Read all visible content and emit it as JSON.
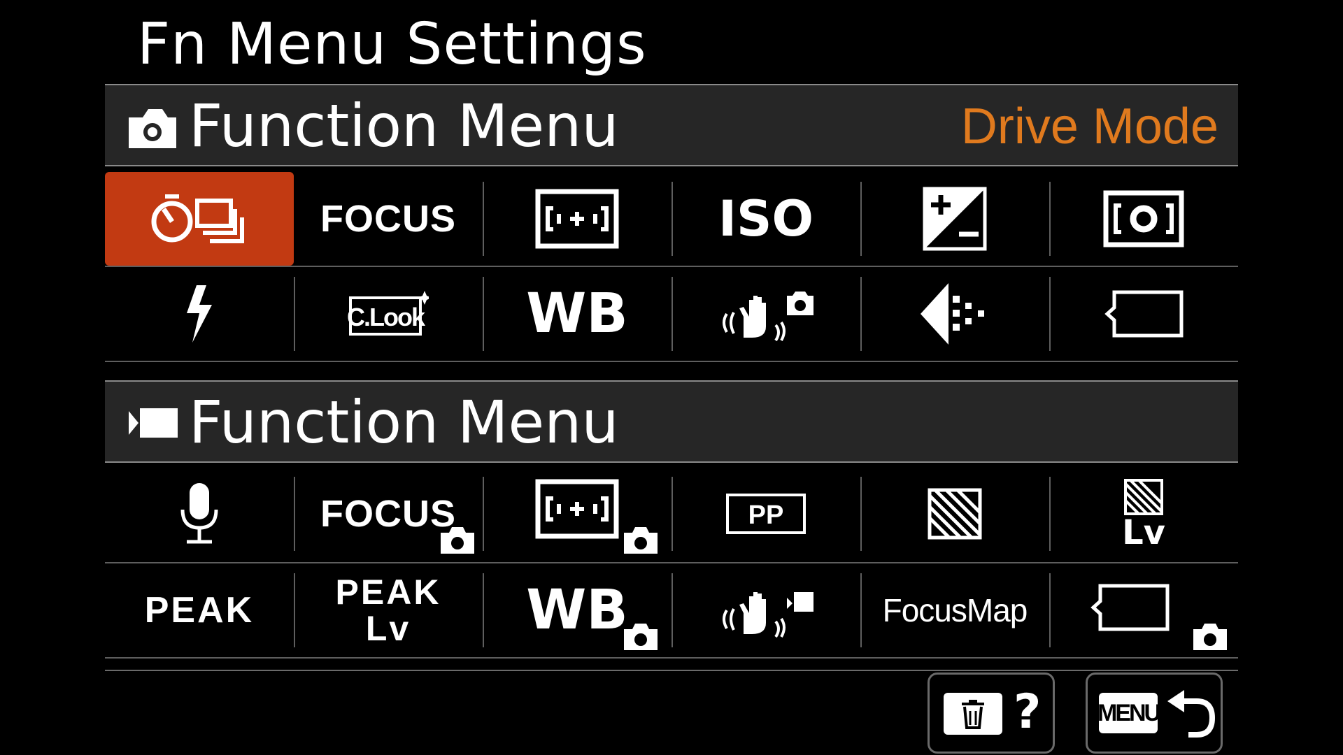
{
  "screen_title": "Fn Menu Settings",
  "photo_section": {
    "label": "Function Menu",
    "selected_item_name": "Drive Mode",
    "row1": [
      "",
      "FOCUS",
      "",
      "ISO",
      "",
      ""
    ],
    "row2": [
      "",
      "C.Look",
      "WB",
      "",
      "",
      ""
    ]
  },
  "movie_section": {
    "label": "Function Menu",
    "row1": [
      "",
      "FOCUS",
      "",
      "PP",
      "",
      "Lv"
    ],
    "row2": [
      "PEAK",
      "PEAK\nLv",
      "WB",
      "",
      "FocusMap",
      ""
    ]
  },
  "footer": {
    "help_label": "?",
    "menu_label": "MENU"
  },
  "colors": {
    "selection": "#c23a12",
    "selected_name": "#e07a1e",
    "header_bg": "#262626"
  }
}
